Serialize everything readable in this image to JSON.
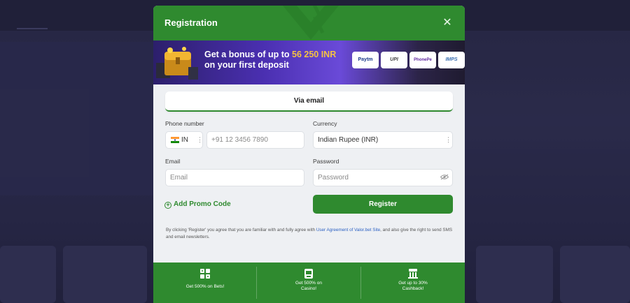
{
  "modal": {
    "title": "Registration",
    "close_icon": "close-icon"
  },
  "promo": {
    "line1_prefix": "Get a bonus of up to ",
    "amount": "56 250 INR",
    "line2": "on your first deposit",
    "payment_methods": [
      "Paytm",
      "UPI",
      "PhonePe",
      "IMPS"
    ]
  },
  "tabs": {
    "email": "Via email"
  },
  "form": {
    "phone_label": "Phone number",
    "country_code": "IN",
    "phone_placeholder": "+91 12 3456 7890",
    "currency_label": "Currency",
    "currency_value": "Indian Rupee (INR)",
    "email_label": "Email",
    "email_placeholder": "Email",
    "password_label": "Password",
    "password_placeholder": "Password",
    "promo_code": "Add Promo Code",
    "register": "Register"
  },
  "disclaimer": {
    "before_link": "By clicking 'Register' you agree that you are familiar with and fully agree with ",
    "link": "User Agreement of Valor.bet Site",
    "after_link": ", and also give the right to send SMS and email newsletters."
  },
  "bonuses": [
    {
      "icon": "dice-icon",
      "text": "Get 500% on Bets!"
    },
    {
      "icon": "casino-icon",
      "text": "Get 500% on Casino!"
    },
    {
      "icon": "cashback-icon",
      "text": "Get up to 30% Cashback!"
    }
  ],
  "colors": {
    "brand_green": "#2f8a2f",
    "promo_amount": "#f5c242",
    "link_blue": "#2a5fc2"
  }
}
